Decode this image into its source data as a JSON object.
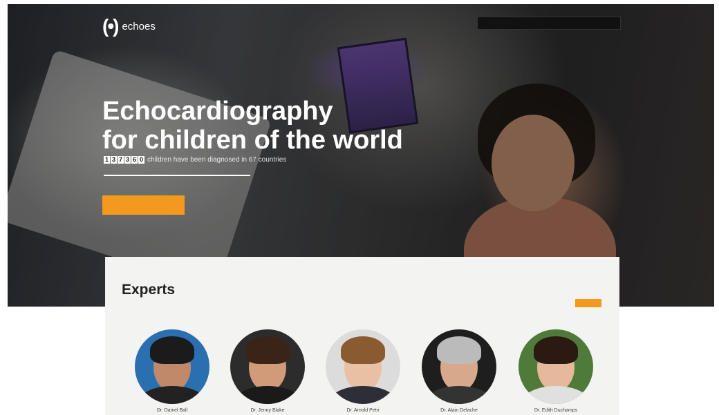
{
  "header": {
    "logo_icon": "(•)",
    "logo_text": "echoes",
    "nav_links": [
      "",
      ""
    ],
    "cta": ""
  },
  "hero": {
    "title_line1": "Echocardiography",
    "title_line2": "for children of the world",
    "counter_digits": [
      "1",
      "3",
      "7",
      "3",
      "6",
      "0"
    ],
    "counter_suffix": "children have been diagnosed in 67 countries",
    "button": ""
  },
  "experts": {
    "title": "Experts",
    "subtitle": "",
    "more_button": "",
    "people": [
      {
        "name": "Dr. Daniel Ball"
      },
      {
        "name": "Dr. Jenny Blake"
      },
      {
        "name": "Dr. Arnold Petri"
      },
      {
        "name": "Dr. Alain Delache"
      },
      {
        "name": "Dr. Edith Duchamps"
      }
    ]
  },
  "colors": {
    "accent": "#f39a1e",
    "hero_overlay": "#2b2b2b",
    "card_bg": "#f3f3f1"
  }
}
